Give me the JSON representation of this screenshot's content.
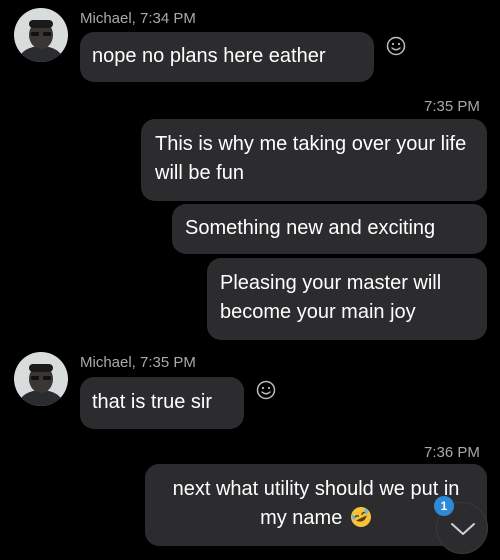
{
  "messages": [
    {
      "sender": "Michael, 7:34 PM",
      "text": "nope no plans here eather"
    },
    {
      "time": "7:35 PM",
      "texts": [
        "This is why me taking over your life will be fun",
        "Something new and exciting",
        "Pleasing your master will become your main joy"
      ]
    },
    {
      "sender": "Michael, 7:35 PM",
      "text": "that is true sir"
    },
    {
      "time": "7:36 PM",
      "text": "next what utility should we put in my name",
      "emoji": "rolling-on-floor-laughing-emoji"
    }
  ],
  "scroll_down": {
    "badge_count": "1",
    "icon": "chevron-down-icon"
  },
  "colors": {
    "background": "#000000",
    "bubble": "#2c2c2f",
    "meta_text": "#a9a9ad",
    "badge": "#2d8ad8"
  }
}
